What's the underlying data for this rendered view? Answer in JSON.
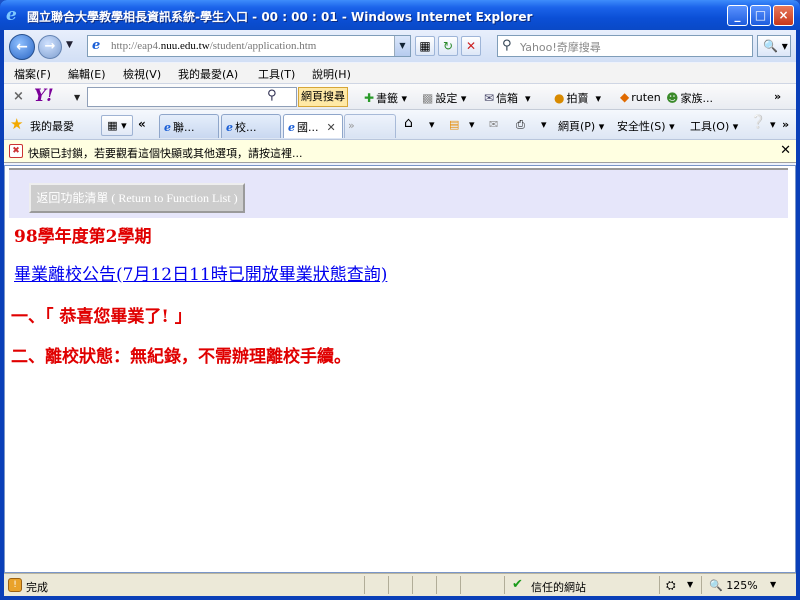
{
  "window": {
    "title": "國立聯合大學教學相長資訊系統-學生入口 - 00 : 00 : 01 - Windows Internet Explorer",
    "controls": [
      "_",
      "□",
      "×"
    ]
  },
  "address_bar": {
    "url_prefix": "http://eap4.",
    "url_host": "nuu.edu.tw",
    "url_path": "/student/application.htm",
    "search_placeholder": "Yahoo!奇摩搜尋"
  },
  "menu": [
    "檔案(F)",
    "編輯(E)",
    "檢視(V)",
    "我的最愛(A)",
    "工具(T)",
    "說明(H)"
  ],
  "yahoo_toolbar": {
    "logo": "Y!",
    "search_button": "網頁搜尋",
    "items": [
      "書籤",
      "設定",
      "信箱",
      "拍賣",
      "ruten",
      "家族"
    ]
  },
  "favorites": {
    "label": "我的最愛",
    "tabs": [
      {
        "label": "聯..."
      },
      {
        "label": "校..."
      },
      {
        "label": "國..."
      }
    ],
    "commands": [
      "網頁(P)",
      "安全性(S)",
      "工具(O)"
    ]
  },
  "info_bar": {
    "text": "快顯已封鎖，若要觀看這個快顯或其他選項，請按這裡..."
  },
  "content": {
    "return_button": "返回功能清單 ( Return to Function List )",
    "term": "98學年度第2學期",
    "notice_link": "畢業離校公告(7月12日11時已開放畢業狀態查詢)",
    "line1": "一、「 恭喜您畢業了! 」",
    "line2": "二、離校狀態：無紀錄，不需辦理離校手續。"
  },
  "status_bar": {
    "status": "完成",
    "zone": "信任的網站",
    "zoom": "125%"
  },
  "colors": {
    "title_blue": "#0b4fd6",
    "content_red": "#e00000",
    "link_blue": "#0000ee",
    "panel_lavender": "#e6e6fa"
  }
}
